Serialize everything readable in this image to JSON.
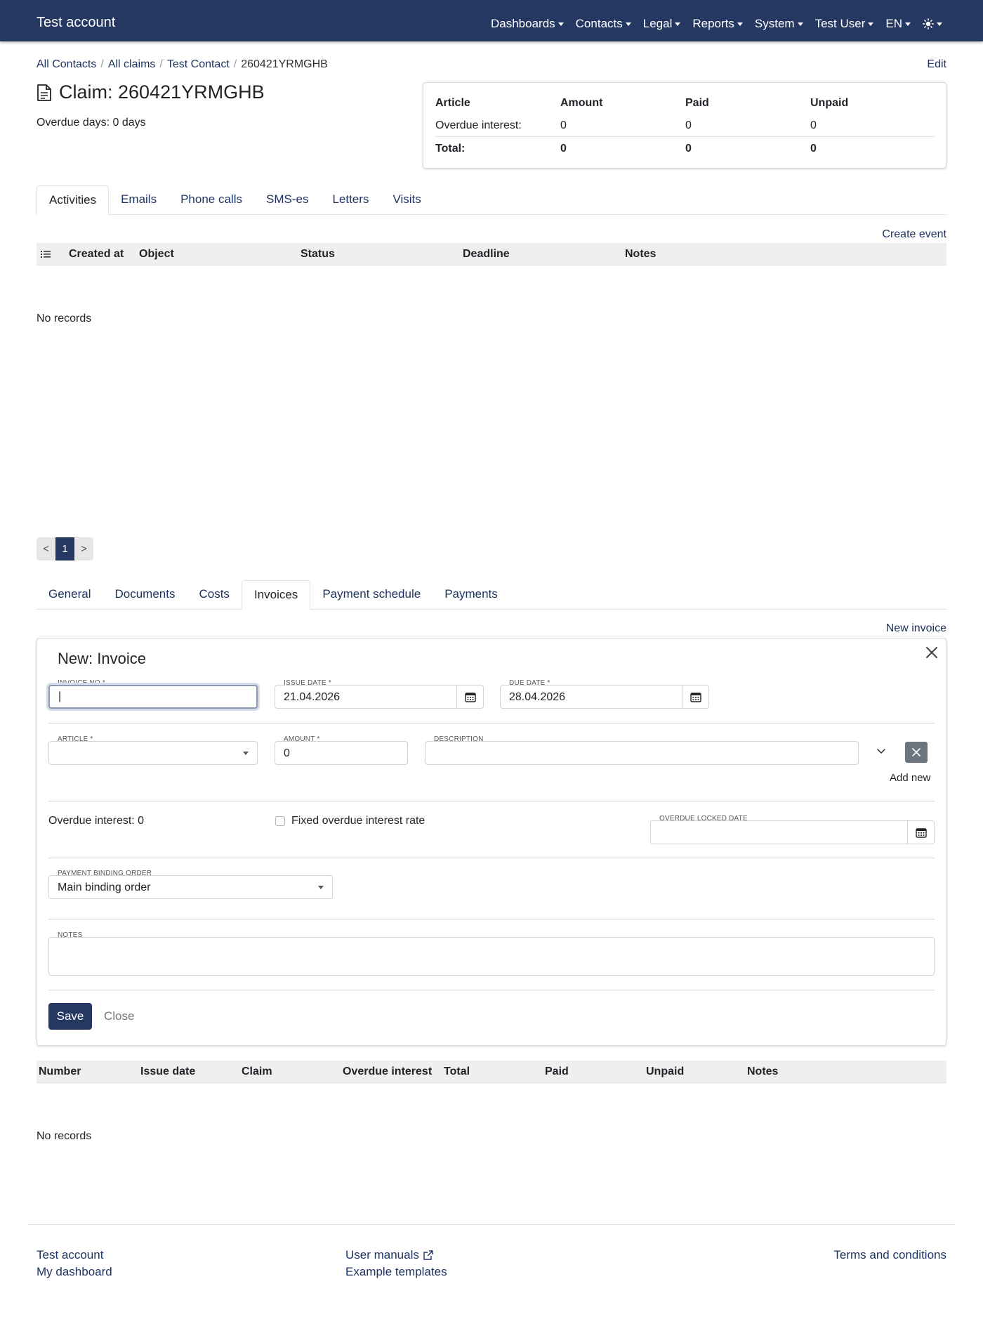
{
  "navbar": {
    "brand": "Test account",
    "menu": [
      {
        "label": "Dashboards"
      },
      {
        "label": "Contacts"
      },
      {
        "label": "Legal"
      },
      {
        "label": "Reports"
      },
      {
        "label": "System"
      },
      {
        "label": "Test User"
      },
      {
        "label": "EN"
      }
    ],
    "theme_icon": "sun-icon"
  },
  "breadcrumb": {
    "items": [
      "All Contacts",
      "All claims",
      "Test Contact"
    ],
    "active": "260421YRMGHB",
    "edit_label": "Edit"
  },
  "claim": {
    "title": "Claim: 260421YRMGHB",
    "overdue_days": "Overdue days: 0 days"
  },
  "summary": {
    "headers": [
      "Article",
      "Amount",
      "Paid",
      "Unpaid"
    ],
    "rows": [
      [
        "Overdue interest:",
        "0",
        "0",
        "0"
      ]
    ],
    "total": [
      "Total:",
      "0",
      "0",
      "0"
    ]
  },
  "activity_tabs": {
    "tabs": [
      "Activities",
      "Emails",
      "Phone calls",
      "SMS-es",
      "Letters",
      "Visits"
    ],
    "active": "Activities",
    "create_event": "Create event",
    "columns": [
      "Created at",
      "Object",
      "Status",
      "Deadline",
      "Notes"
    ],
    "no_records": "No records"
  },
  "pagination": {
    "prev": "<",
    "current": "1",
    "next": ">"
  },
  "claim_tabs": {
    "tabs": [
      "General",
      "Documents",
      "Costs",
      "Invoices",
      "Payment schedule",
      "Payments"
    ],
    "active": "Invoices",
    "new_invoice": "New invoice"
  },
  "invoice_form": {
    "title": "New: Invoice",
    "invoice_no_label": "INVOICE NO *",
    "invoice_no_value": "|",
    "issue_date_label": "ISSUE DATE *",
    "issue_date_value": "21.04.2026",
    "due_date_label": "DUE DATE *",
    "due_date_value": "28.04.2026",
    "article_label": "ARTICLE *",
    "article_value": "",
    "amount_label": "AMOUNT *",
    "amount_value": "0",
    "description_label": "DESCRIPTION",
    "description_value": "",
    "add_new": "Add new",
    "overdue_interest": "Overdue interest: 0",
    "fixed_rate_label": "Fixed overdue interest rate",
    "fixed_rate_checked": false,
    "overdue_locked_label": "OVERDUE LOCKED DATE",
    "overdue_locked_value": "",
    "payment_binding_label": "PAYMENT BINDING ORDER",
    "payment_binding_value": "Main binding order",
    "notes_label": "NOTES",
    "notes_value": "",
    "save_label": "Save",
    "close_label": "Close"
  },
  "invoices_table": {
    "columns": [
      "Number",
      "Issue date",
      "Claim",
      "Overdue interest",
      "Total",
      "Paid",
      "Unpaid",
      "Notes"
    ],
    "no_records": "No records"
  },
  "footer": {
    "col1": [
      "Test account",
      "My dashboard"
    ],
    "col2": [
      "User manuals",
      "Example templates"
    ],
    "col3": [
      "Terms and conditions"
    ]
  },
  "colors": {
    "navbar": "#253861",
    "link": "#1f3460",
    "header_bg": "#efefef"
  }
}
